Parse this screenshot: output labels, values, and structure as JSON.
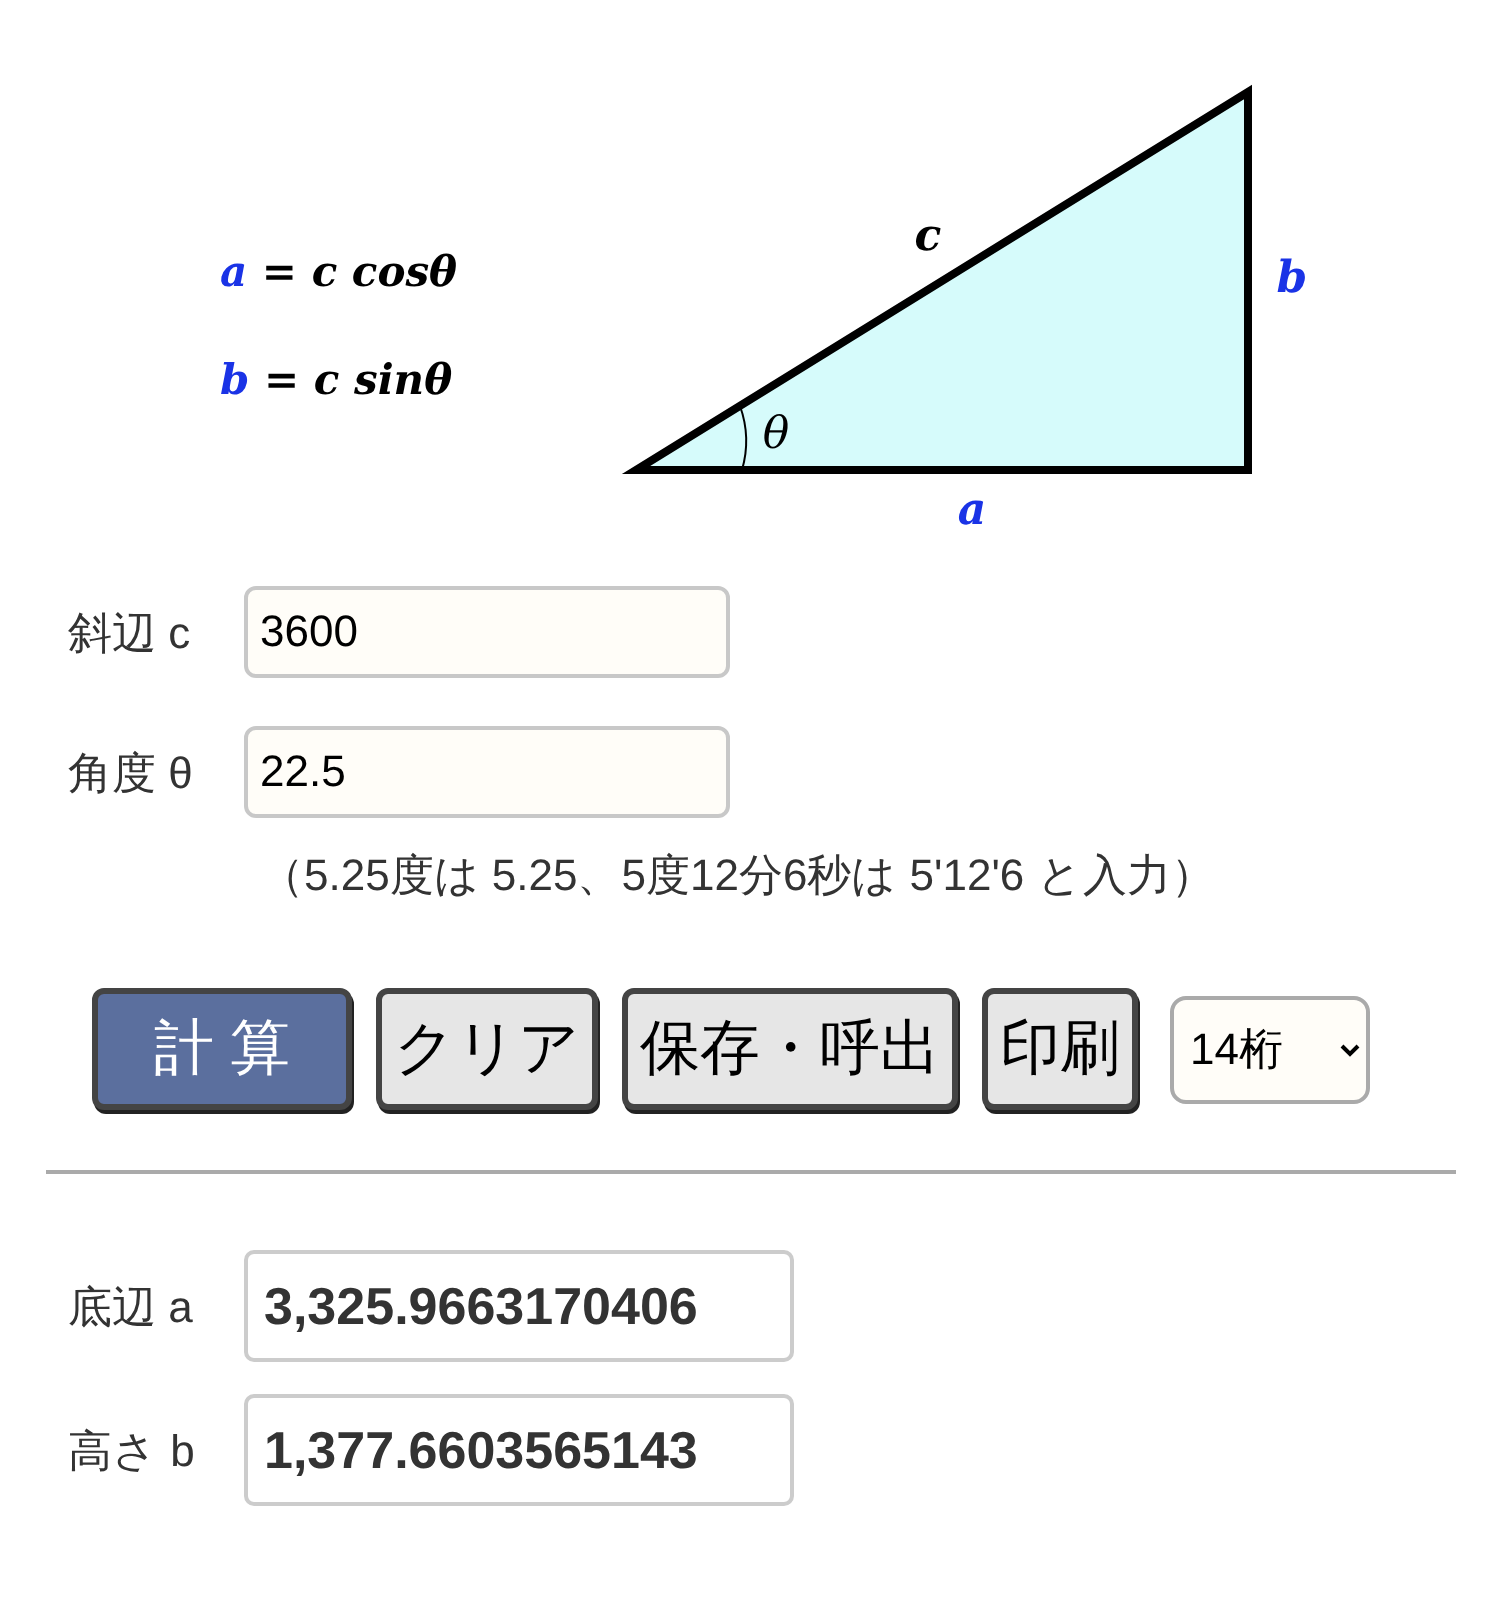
{
  "diagram": {
    "formulas": [
      {
        "variable": "a",
        "expression": "= c cosθ"
      },
      {
        "variable": "b",
        "expression": "= c sinθ"
      }
    ],
    "labels": [
      {
        "kind": "hypotenuse",
        "text": "c"
      },
      {
        "kind": "height",
        "text": "b"
      },
      {
        "kind": "base",
        "text": "a"
      },
      {
        "kind": "angle",
        "text": "θ"
      }
    ]
  },
  "inputs": [
    {
      "label": "斜辺 c",
      "value": "3600"
    },
    {
      "label": "角度 θ",
      "value": "22.5"
    }
  ],
  "note": "（5.25度は 5.25、5度12分6秒は 5'12'6 と入力）",
  "buttons": [
    {
      "kind": "primary",
      "label": "計 算"
    },
    {
      "kind": "plain",
      "label": "クリア"
    },
    {
      "kind": "plain",
      "label": "保存・呼出"
    },
    {
      "kind": "plain",
      "label": "印刷"
    }
  ],
  "digits": "14桁",
  "results": [
    {
      "label": "底辺 a",
      "value": "3,325.9663170406"
    },
    {
      "label": "高さ b",
      "value": "1,377.6603565143"
    }
  ]
}
